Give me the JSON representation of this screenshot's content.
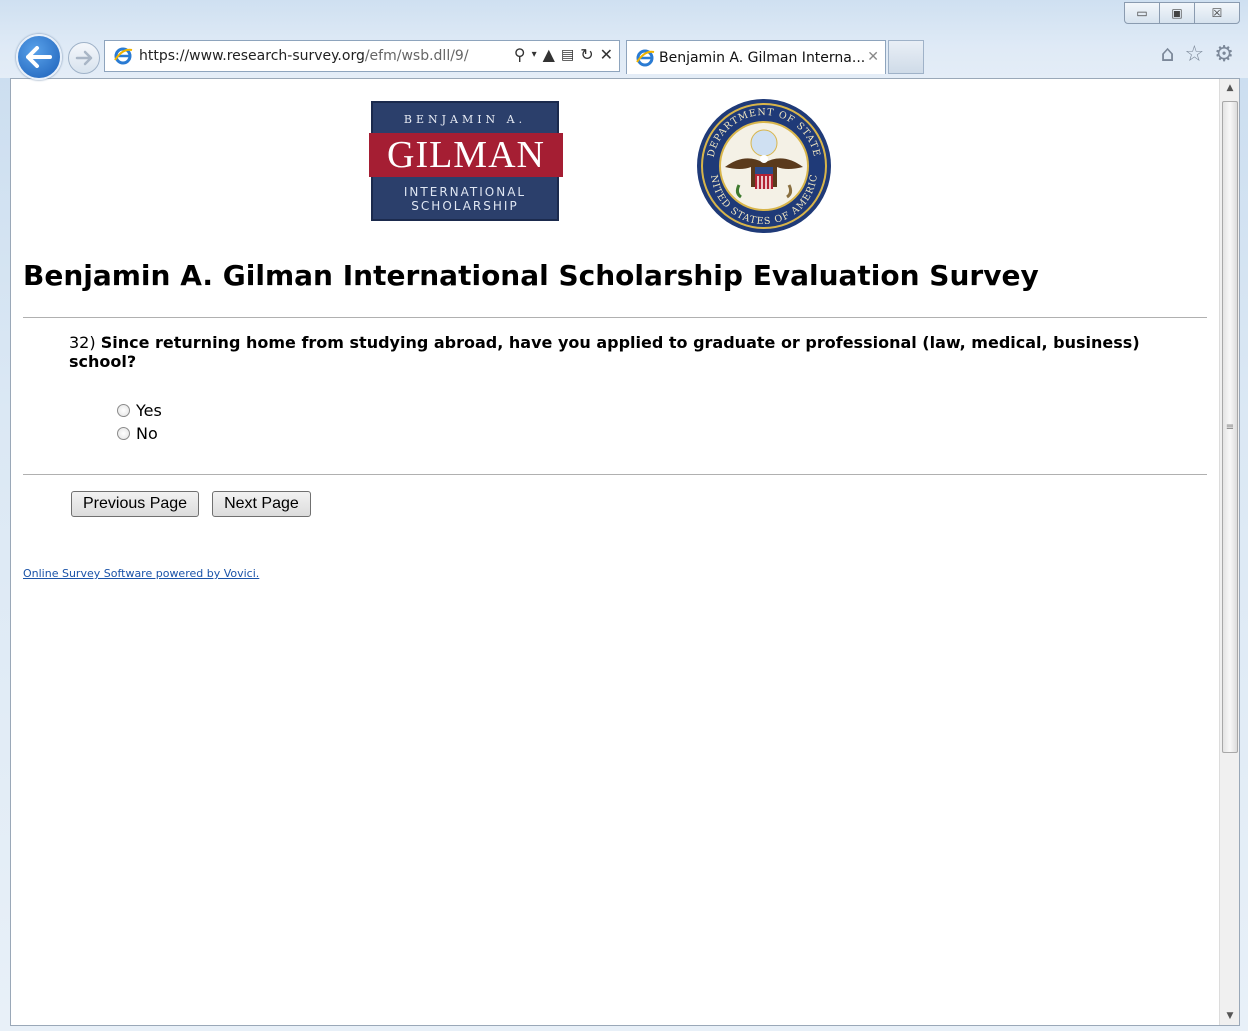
{
  "browser": {
    "url_prefix": "https://www.research-survey.org",
    "url_rest": "/efm/wsb.dll/9/",
    "tab_title": "Benjamin A. Gilman Interna...",
    "icons": [
      "back-arrow-icon",
      "forward-arrow-icon",
      "ie-icon",
      "search-icon",
      "dropdown-icon",
      "lock-icon",
      "compat-icon",
      "refresh-icon",
      "stop-icon",
      "close-icon",
      "home-icon",
      "favorites-star-icon",
      "gear-icon"
    ]
  },
  "window": {
    "minimize": "▭",
    "maximize": "▣",
    "close": "☒"
  },
  "logos": {
    "gilman_top": "BENJAMIN A.",
    "gilman_mid": "GILMAN",
    "gilman_bot1": "INTERNATIONAL",
    "gilman_bot2": "SCHOLARSHIP",
    "seal_top": "DEPARTMENT OF STATE",
    "seal_bottom": "UNITED STATES OF AMERICA"
  },
  "page": {
    "title": "Benjamin A. Gilman International Scholarship Evaluation Survey"
  },
  "question": {
    "number": "32)",
    "text": "Since returning home from studying abroad, have you applied to graduate or professional (law, medical, business) school?",
    "options": [
      "Yes",
      "No"
    ]
  },
  "buttons": {
    "previous": "Previous Page",
    "next": "Next Page"
  },
  "footer": {
    "link": "Online Survey Software powered by Vovici."
  },
  "colors": {
    "gilman_blue": "#2b3f6b",
    "gilman_red": "#a51e33",
    "link_blue": "#1a53a8"
  }
}
